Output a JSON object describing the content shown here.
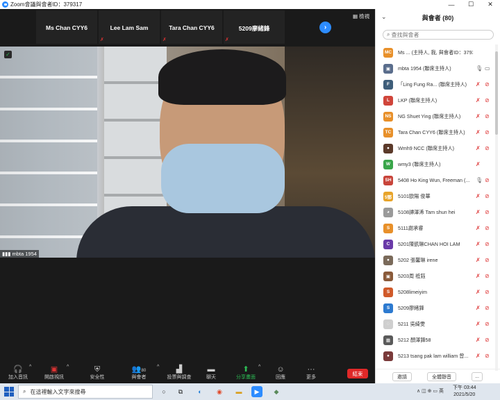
{
  "window": {
    "title": "Zoom會議與會者ID：379317",
    "min": "—",
    "max": "☐",
    "close": "✕"
  },
  "strip": {
    "thumbs": [
      "Ms Chan CYY6",
      "Lee Lam Sam",
      "Tara Chan CYY6",
      "5209廖緒鋒"
    ],
    "gallery_label": "▦ 檢視"
  },
  "speaker": {
    "name_label": "mbta 1954"
  },
  "toolbar": {
    "join_audio": "加入音訊",
    "start_video": "開啟視訊",
    "security": "安全性",
    "participants": "與會者",
    "participants_count": "80",
    "polls": "投票與調查",
    "chat": "聊天",
    "share": "分享畫面",
    "reactions": "回應",
    "more": "更多",
    "end": "結束"
  },
  "panel": {
    "title": "與會者 (80)",
    "search_placeholder": "查找與會者",
    "participants": [
      {
        "initials": "MC",
        "color": "#e8902a",
        "name": "Ms ... (主持人, 我, 與會者ID：379317)",
        "mic": "none",
        "cam": "none"
      },
      {
        "initials": "▣",
        "color": "#5a6d8c",
        "name": "mbta 1954 (聯席主持人)",
        "mic": "on",
        "cam": "on"
      },
      {
        "initials": "F",
        "color": "#3f5e7a",
        "name": "「Ling Fung Ra... (聯席主持人)",
        "mic": "off",
        "cam": "off"
      },
      {
        "initials": "L",
        "color": "#d0453a",
        "name": "LKP (聯席主持人)",
        "mic": "off",
        "cam": "off"
      },
      {
        "initials": "NS",
        "color": "#e8902a",
        "name": "NG Shuet Ying (聯席主持人)",
        "mic": "off",
        "cam": "off"
      },
      {
        "initials": "TC",
        "color": "#e8902a",
        "name": "Tara Chan CYY6 (聯席主持人)",
        "mic": "off",
        "cam": "off"
      },
      {
        "initials": "●",
        "color": "#5b3a2a",
        "name": "Wmh9 NCC (聯席主持人)",
        "mic": "off",
        "cam": "off"
      },
      {
        "initials": "W",
        "color": "#3aa64a",
        "name": "wmy3 (聯席主持人)",
        "mic": "off",
        "cam": "none"
      },
      {
        "initials": "SH",
        "color": "#c8443a",
        "name": "5408 Ho King Wun, Freeman (...",
        "mic": "on",
        "cam": "off"
      },
      {
        "initials": "5鄧",
        "color": "#e8a42a",
        "name": "5101歐陽 俊華",
        "mic": "off",
        "cam": "off"
      },
      {
        "initials": "◕",
        "color": "#9a9a9a",
        "name": "5108譚澤浠 Tam shun hei",
        "mic": "off",
        "cam": "off"
      },
      {
        "initials": "S",
        "color": "#e8902a",
        "name": "5111謝承睿",
        "mic": "off",
        "cam": "off"
      },
      {
        "initials": "C",
        "color": "#6a3aa8",
        "name": "5201陳凱琳CHAN HOI LAM",
        "mic": "off",
        "cam": "off"
      },
      {
        "initials": "●",
        "color": "#7a6a5a",
        "name": "5202 張馨琳 irene",
        "mic": "off",
        "cam": "off"
      },
      {
        "initials": "▣",
        "color": "#8a5a3a",
        "name": "5203周 祗鈺",
        "mic": "off",
        "cam": "off"
      },
      {
        "initials": "S",
        "color": "#d05a2a",
        "name": "5208limeiyim",
        "mic": "off",
        "cam": "off"
      },
      {
        "initials": "S",
        "color": "#2d7ad0",
        "name": "5209廖緒鋒",
        "mic": "off",
        "cam": "off"
      },
      {
        "initials": "◌",
        "color": "#cfcfcf",
        "name": "5211 吳綺雯",
        "mic": "off",
        "cam": "off"
      },
      {
        "initials": "▦",
        "color": "#5a5a5a",
        "name": "5212 顏澤鋒58",
        "mic": "off",
        "cam": "off"
      },
      {
        "initials": "●",
        "color": "#7a3a3a",
        "name": "5213 tsang pak lam william 曾...",
        "mic": "off",
        "cam": "off"
      }
    ],
    "footer": {
      "invite": "邀請",
      "mute_all": "全體靜音",
      "more": "..."
    }
  },
  "taskbar": {
    "search_placeholder": "在這裡輸入文字來搜尋",
    "tray_text": "∧ ◫ ⊕ ▭ 英",
    "time": "下午 03:44",
    "date": "2021/5/20"
  }
}
